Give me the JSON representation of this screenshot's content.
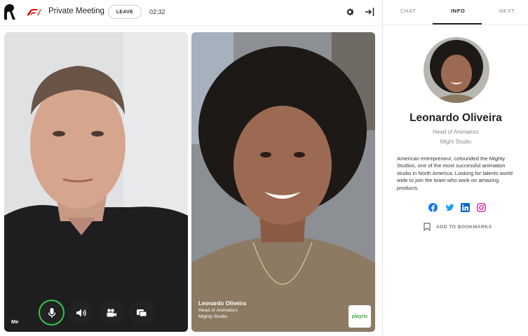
{
  "header": {
    "title": "Private Meeting",
    "leave_label": "LEAVE",
    "timer": "02:32"
  },
  "tabs": [
    {
      "label": "CHAT"
    },
    {
      "label": "INFO"
    },
    {
      "label": "NEXT"
    }
  ],
  "profile": {
    "name": "Leonardo Oliveira",
    "role": "Head of Animators",
    "company": "Might Studio",
    "bio": "American entrepreneur, cofounded the Mighty Studios, one of the most successful animation studio in North America. Looking for talents world wide to join the team who work on amazing products.",
    "bookmark_label": "ADD TO BOOKMARKS"
  },
  "video_me": {
    "label": "Me"
  },
  "video_guest": {
    "name": "Leonardo Oliveira",
    "role": "Head of Animators",
    "company": "Mighty Studio",
    "badge": "playrix"
  },
  "colors": {
    "accent_green": "#39c44d",
    "facebook": "#1877f2",
    "twitter": "#1da1f2",
    "linkedin": "#0a66c2",
    "instagram": "#d6249f"
  }
}
